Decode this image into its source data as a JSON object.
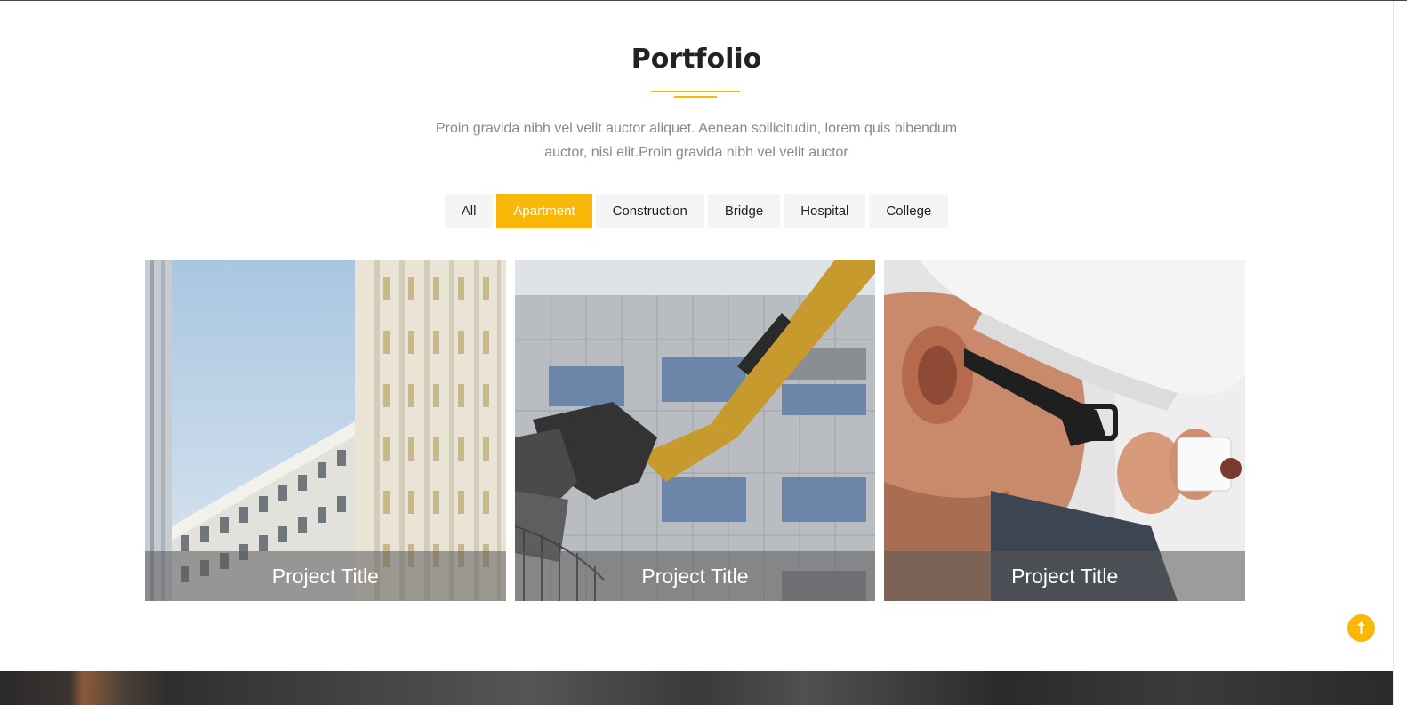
{
  "portfolio": {
    "title": "Portfolio",
    "description": "Proin gravida nibh vel velit auctor aliquet. Aenean sollicitudin, lorem quis bibendum auctor, nisi elit.Proin gravida nibh vel velit auctor",
    "accent_color": "#f9b707"
  },
  "filters": {
    "all": "All",
    "apartment": "Apartment",
    "construction": "Construction",
    "bridge": "Bridge",
    "hospital": "Hospital",
    "college": "College",
    "active": "Apartment"
  },
  "projects": [
    {
      "title": "Project Title",
      "image": "modern-curved-building-photo"
    },
    {
      "title": "Project Title",
      "image": "excavator-demolition-photo"
    },
    {
      "title": "Project Title",
      "image": "electrician-hard-hat-photo"
    }
  ],
  "scroll_top": {
    "icon": "arrow-up-icon"
  }
}
